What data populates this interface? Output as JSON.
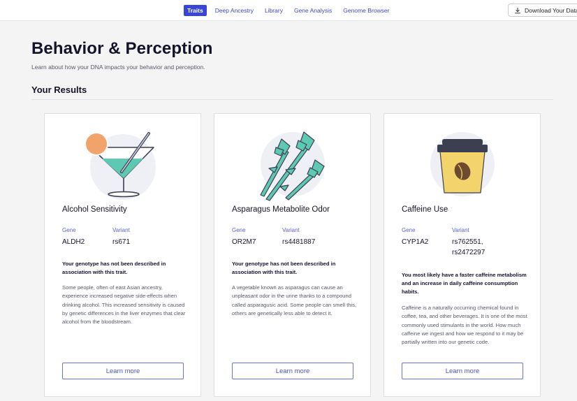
{
  "nav": {
    "items": [
      {
        "label": "Traits",
        "active": true
      },
      {
        "label": "Deep Ancestry",
        "active": false
      },
      {
        "label": "Library",
        "active": false
      },
      {
        "label": "Gene Analysis",
        "active": false
      },
      {
        "label": "Genome Browser",
        "active": false
      }
    ],
    "download_label": "Download Your Data"
  },
  "page": {
    "title": "Behavior & Perception",
    "subtitle": "Learn about how your DNA impacts your behavior and perception.",
    "section_title": "Your Results"
  },
  "cards": [
    {
      "title": "Alcohol Sensitivity",
      "gene_label": "Gene",
      "gene": "ALDH2",
      "variant_label": "Variant",
      "variant": "rs671",
      "result": "Your genotype has not been described in association with this trait.",
      "description": "Some people, often of east Asian ancestry, experience increased negative side-effects when drinking alcohol. This increased sensitivity is caused by genetic differences in the liver enzymes that clear alcohol from the bloodstream.",
      "button": "Learn more",
      "icon": "martini-icon"
    },
    {
      "title": "Asparagus Metabolite Odor",
      "gene_label": "Gene",
      "gene": "OR2M7",
      "variant_label": "Variant",
      "variant": "rs4481887",
      "result": "Your genotype has not been described in association with this trait.",
      "description": "A vegetable known as asparagus can cause an unpleasant odor in the urine thanks to a compound called asparagusic acid. Some people can smell this, others are genetically less able to detect it.",
      "button": "Learn more",
      "icon": "asparagus-icon"
    },
    {
      "title": "Caffeine Use",
      "gene_label": "Gene",
      "gene": "CYP1A2",
      "variant_label": "Variant",
      "variant_line1": "rs762551,",
      "variant_line2": "rs2472297",
      "result": "You most likely have a faster caffeine metabolism and an increase in daily caffeine consumption habits.",
      "description": "Caffeine is a naturally occurring chemical found in coffee, tea, and other beverages. It is one of the most commonly used stimulants in the world. How much caffeine we ingest and how we respond to it may be partially written into our genetic code.",
      "button": "Learn more",
      "icon": "coffee-cup-icon"
    }
  ],
  "colors": {
    "accent": "#3a46d6",
    "illustration_teal": "#5ec9b3",
    "illustration_bg": "#eef0f6",
    "orange": "#f2a36a",
    "cup_yellow": "#f3d36b",
    "lid_dark": "#3b3f4f"
  }
}
